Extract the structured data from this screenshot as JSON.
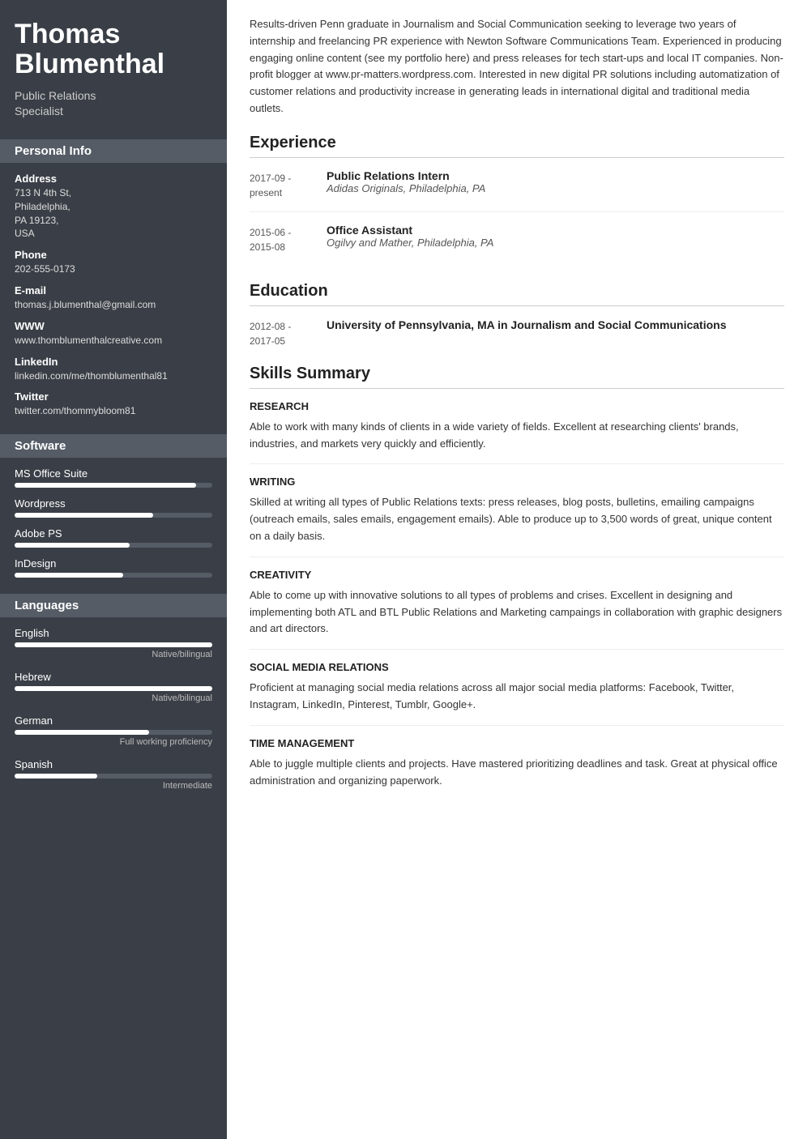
{
  "sidebar": {
    "name": "Thomas\nBlumenthal",
    "title": "Public Relations\nSpecialist",
    "personal_info_label": "Personal Info",
    "address_label": "Address",
    "address_value": "713 N 4th St,\nPhiladelphia,\nPA 19123,\nUSA",
    "phone_label": "Phone",
    "phone_value": "202-555-0173",
    "email_label": "E-mail",
    "email_value": "thomas.j.blumenthal@gmail.com",
    "www_label": "WWW",
    "www_value": "www.thomblumenthalcreative.com",
    "linkedin_label": "LinkedIn",
    "linkedin_value": "linkedin.com/me/thomblumenthal81",
    "twitter_label": "Twitter",
    "twitter_value": "twitter.com/thommybloom81",
    "software_label": "Software",
    "software": [
      {
        "name": "MS Office Suite",
        "pct": 92
      },
      {
        "name": "Wordpress",
        "pct": 70
      },
      {
        "name": "Adobe PS",
        "pct": 58
      },
      {
        "name": "InDesign",
        "pct": 55
      }
    ],
    "languages_label": "Languages",
    "languages": [
      {
        "name": "English",
        "pct": 100,
        "level": "Native/bilingual"
      },
      {
        "name": "Hebrew",
        "pct": 100,
        "level": "Native/bilingual"
      },
      {
        "name": "German",
        "pct": 68,
        "level": "Full working proficiency"
      },
      {
        "name": "Spanish",
        "pct": 42,
        "level": "Intermediate"
      }
    ]
  },
  "main": {
    "summary": "Results-driven Penn graduate in Journalism and Social Communication seeking to leverage two years of internship and freelancing PR experience with Newton Software Communications Team. Experienced in producing engaging online content (see my portfolio here) and press releases for tech start-ups and local IT companies. Non-profit blogger at www.pr-matters.wordpress.com. Interested in new digital PR solutions including automatization of customer relations and productivity increase in generating leads in international digital and traditional media outlets.",
    "experience_title": "Experience",
    "experience": [
      {
        "date": "2017-09 -\npresent",
        "title": "Public Relations Intern",
        "company": "Adidas Originals, Philadelphia, PA"
      },
      {
        "date": "2015-06 -\n2015-08",
        "title": "Office Assistant",
        "company": "Ogilvy and Mather, Philadelphia, PA"
      }
    ],
    "education_title": "Education",
    "education": [
      {
        "date": "2012-08 -\n2017-05",
        "degree": "University of Pennsylvania, MA in Journalism and Social Communications"
      }
    ],
    "skills_title": "Skills Summary",
    "skills": [
      {
        "name": "RESEARCH",
        "desc": "Able to work with many kinds of clients in a wide variety of fields. Excellent at researching clients' brands, industries, and markets very quickly and efficiently."
      },
      {
        "name": "WRITING",
        "desc": "Skilled at writing all types of Public Relations texts: press releases, blog posts, bulletins, emailing campaigns (outreach emails, sales emails, engagement emails). Able to produce up to 3,500 words of great, unique content on a daily basis."
      },
      {
        "name": "CREATIVITY",
        "desc": "Able to come up with innovative solutions to all types of problems and crises. Excellent in designing and implementing both ATL and BTL Public Relations and Marketing campaings in collaboration with graphic designers and art directors."
      },
      {
        "name": "SOCIAL MEDIA RELATIONS",
        "desc": "Proficient at managing social media relations across all major social media platforms: Facebook, Twitter, Instagram, LinkedIn, Pinterest, Tumblr, Google+."
      },
      {
        "name": "TIME MANAGEMENT",
        "desc": "Able to juggle multiple clients and projects. Have mastered prioritizing deadlines and task. Great at physical office administration and organizing paperwork."
      }
    ]
  }
}
